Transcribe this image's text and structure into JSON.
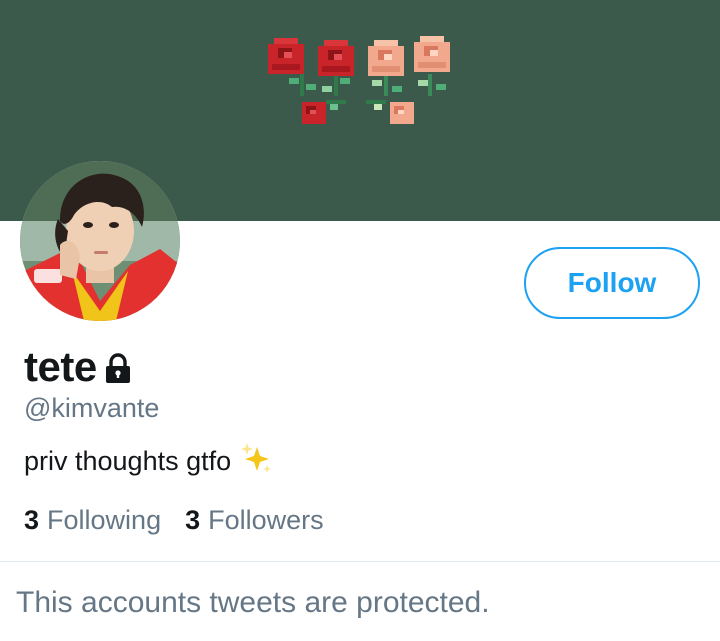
{
  "profile": {
    "display_name": "tete",
    "handle": "@kimvante",
    "bio": "priv thoughts gtfo",
    "bio_emoji": "sparkles-icon",
    "protected_icon": "lock-icon",
    "banner_color": "#3b5a4b",
    "banner_art": "pixel-roses"
  },
  "actions": {
    "follow_label": "Follow",
    "accent_color": "#1da1f2"
  },
  "stats": {
    "following_count": "3",
    "following_label": "Following",
    "followers_count": "3",
    "followers_label": "Followers"
  },
  "timeline": {
    "protected_message": "This accounts tweets are protected."
  }
}
